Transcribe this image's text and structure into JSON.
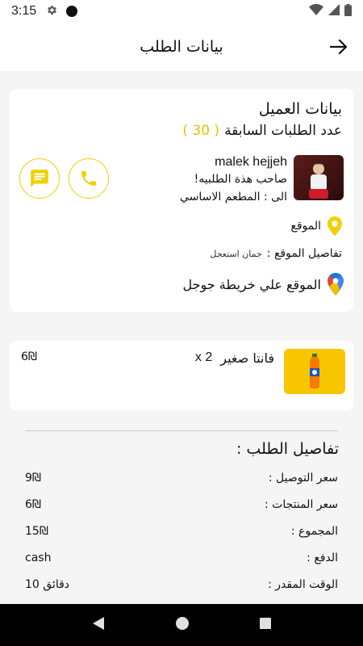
{
  "status": {
    "time": "3:15"
  },
  "header": {
    "title": "بيانات الطلب"
  },
  "customer": {
    "section_title": "بيانات العميل",
    "prev_orders_label": "عدد الطلبات السابقة",
    "prev_orders_count": "( 30 )",
    "name": "malek hejjeh",
    "owner_label": "صاحب هذة الطلبيه!",
    "to_label": "الى : المطعم الاساسي",
    "location_label": "الموقع",
    "location_details_label": "تفاصيل الموقع :",
    "location_details_value": "جمان استعجل",
    "map_link": "الموقع علي خريطة جوجل"
  },
  "item": {
    "name": "فانتا صغير",
    "qty": "x 2",
    "price": "6₪"
  },
  "order_details": {
    "title": "تفاصيل الطلب :",
    "rows": [
      {
        "label": "سعر التوصيل :",
        "value": "9₪"
      },
      {
        "label": "سعر المنتجات :",
        "value": "6₪"
      },
      {
        "label": "المجموع :",
        "value": "15₪"
      },
      {
        "label": "الدفع :",
        "value": "cash"
      },
      {
        "label": "الوقت المقدر :",
        "value": "10 دقائق"
      }
    ]
  },
  "colors": {
    "accent": "#f1d000",
    "count": "#e6c200"
  }
}
